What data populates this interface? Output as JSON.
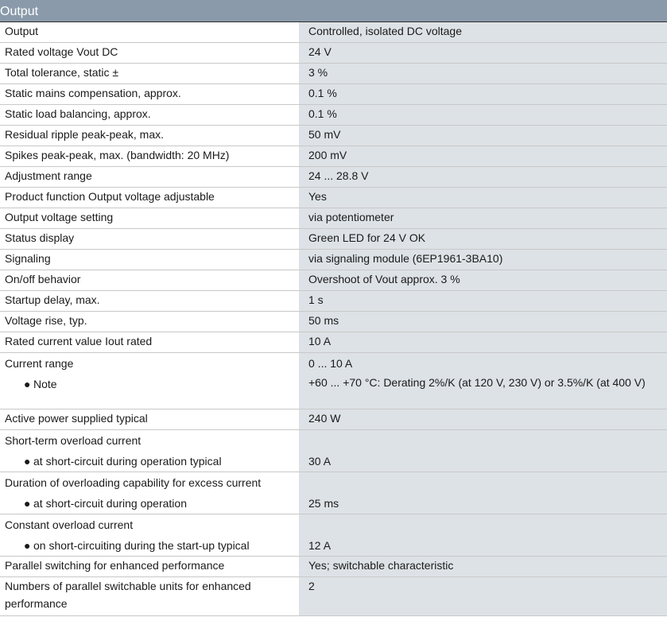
{
  "section": {
    "title": "Output"
  },
  "rows": [
    {
      "label": "Output",
      "value": "Controlled, isolated DC voltage"
    },
    {
      "label": "Rated voltage Vout DC",
      "value": "24 V"
    },
    {
      "label": "Total tolerance, static ±",
      "value": "3 %"
    },
    {
      "label": "Static mains compensation, approx.",
      "value": "0.1 %"
    },
    {
      "label": "Static load balancing, approx.",
      "value": "0.1 %"
    },
    {
      "label": "Residual ripple peak-peak, max.",
      "value": "50 mV"
    },
    {
      "label": "Spikes peak-peak, max. (bandwidth: 20 MHz)",
      "value": "200 mV"
    },
    {
      "label": "Adjustment range",
      "value": "24 ... 28.8 V"
    },
    {
      "label": "Product function Output voltage adjustable",
      "value": "Yes"
    },
    {
      "label": "Output voltage setting",
      "value": "via potentiometer"
    },
    {
      "label": "Status display",
      "value": "Green LED for 24 V OK"
    },
    {
      "label": "Signaling",
      "value": "via signaling module (6EP1961-3BA10)"
    },
    {
      "label": "On/off behavior",
      "value": "Overshoot of Vout approx. 3 %"
    },
    {
      "label": "Startup delay, max.",
      "value": "1 s"
    },
    {
      "label": "Voltage rise, typ.",
      "value": "50 ms"
    },
    {
      "label": "Rated current value Iout rated",
      "value": "10 A"
    },
    {
      "label": "Current range",
      "value": "0 ... 10 A"
    },
    {
      "label": "Note",
      "value": "+60 ... +70 °C: Derating 2%/K (at 120 V, 230 V) or 3.5%/K (at 400 V)"
    },
    {
      "label": "Active power supplied typical",
      "value": "240 W"
    },
    {
      "label": "Short-term overload current",
      "value": ""
    },
    {
      "label": "at short-circuit during operation typical",
      "value": "30 A"
    },
    {
      "label": "Duration of overloading capability for excess current",
      "value": ""
    },
    {
      "label": "at short-circuit during operation",
      "value": "25 ms"
    },
    {
      "label": "Constant overload current",
      "value": ""
    },
    {
      "label": "on short-circuiting during the start-up typical",
      "value": "12 A"
    },
    {
      "label": "Parallel switching for enhanced performance",
      "value": "Yes; switchable characteristic"
    },
    {
      "label": "Numbers of parallel switchable units for enhanced performance",
      "value": "2"
    }
  ],
  "bullet_glyph": "●"
}
